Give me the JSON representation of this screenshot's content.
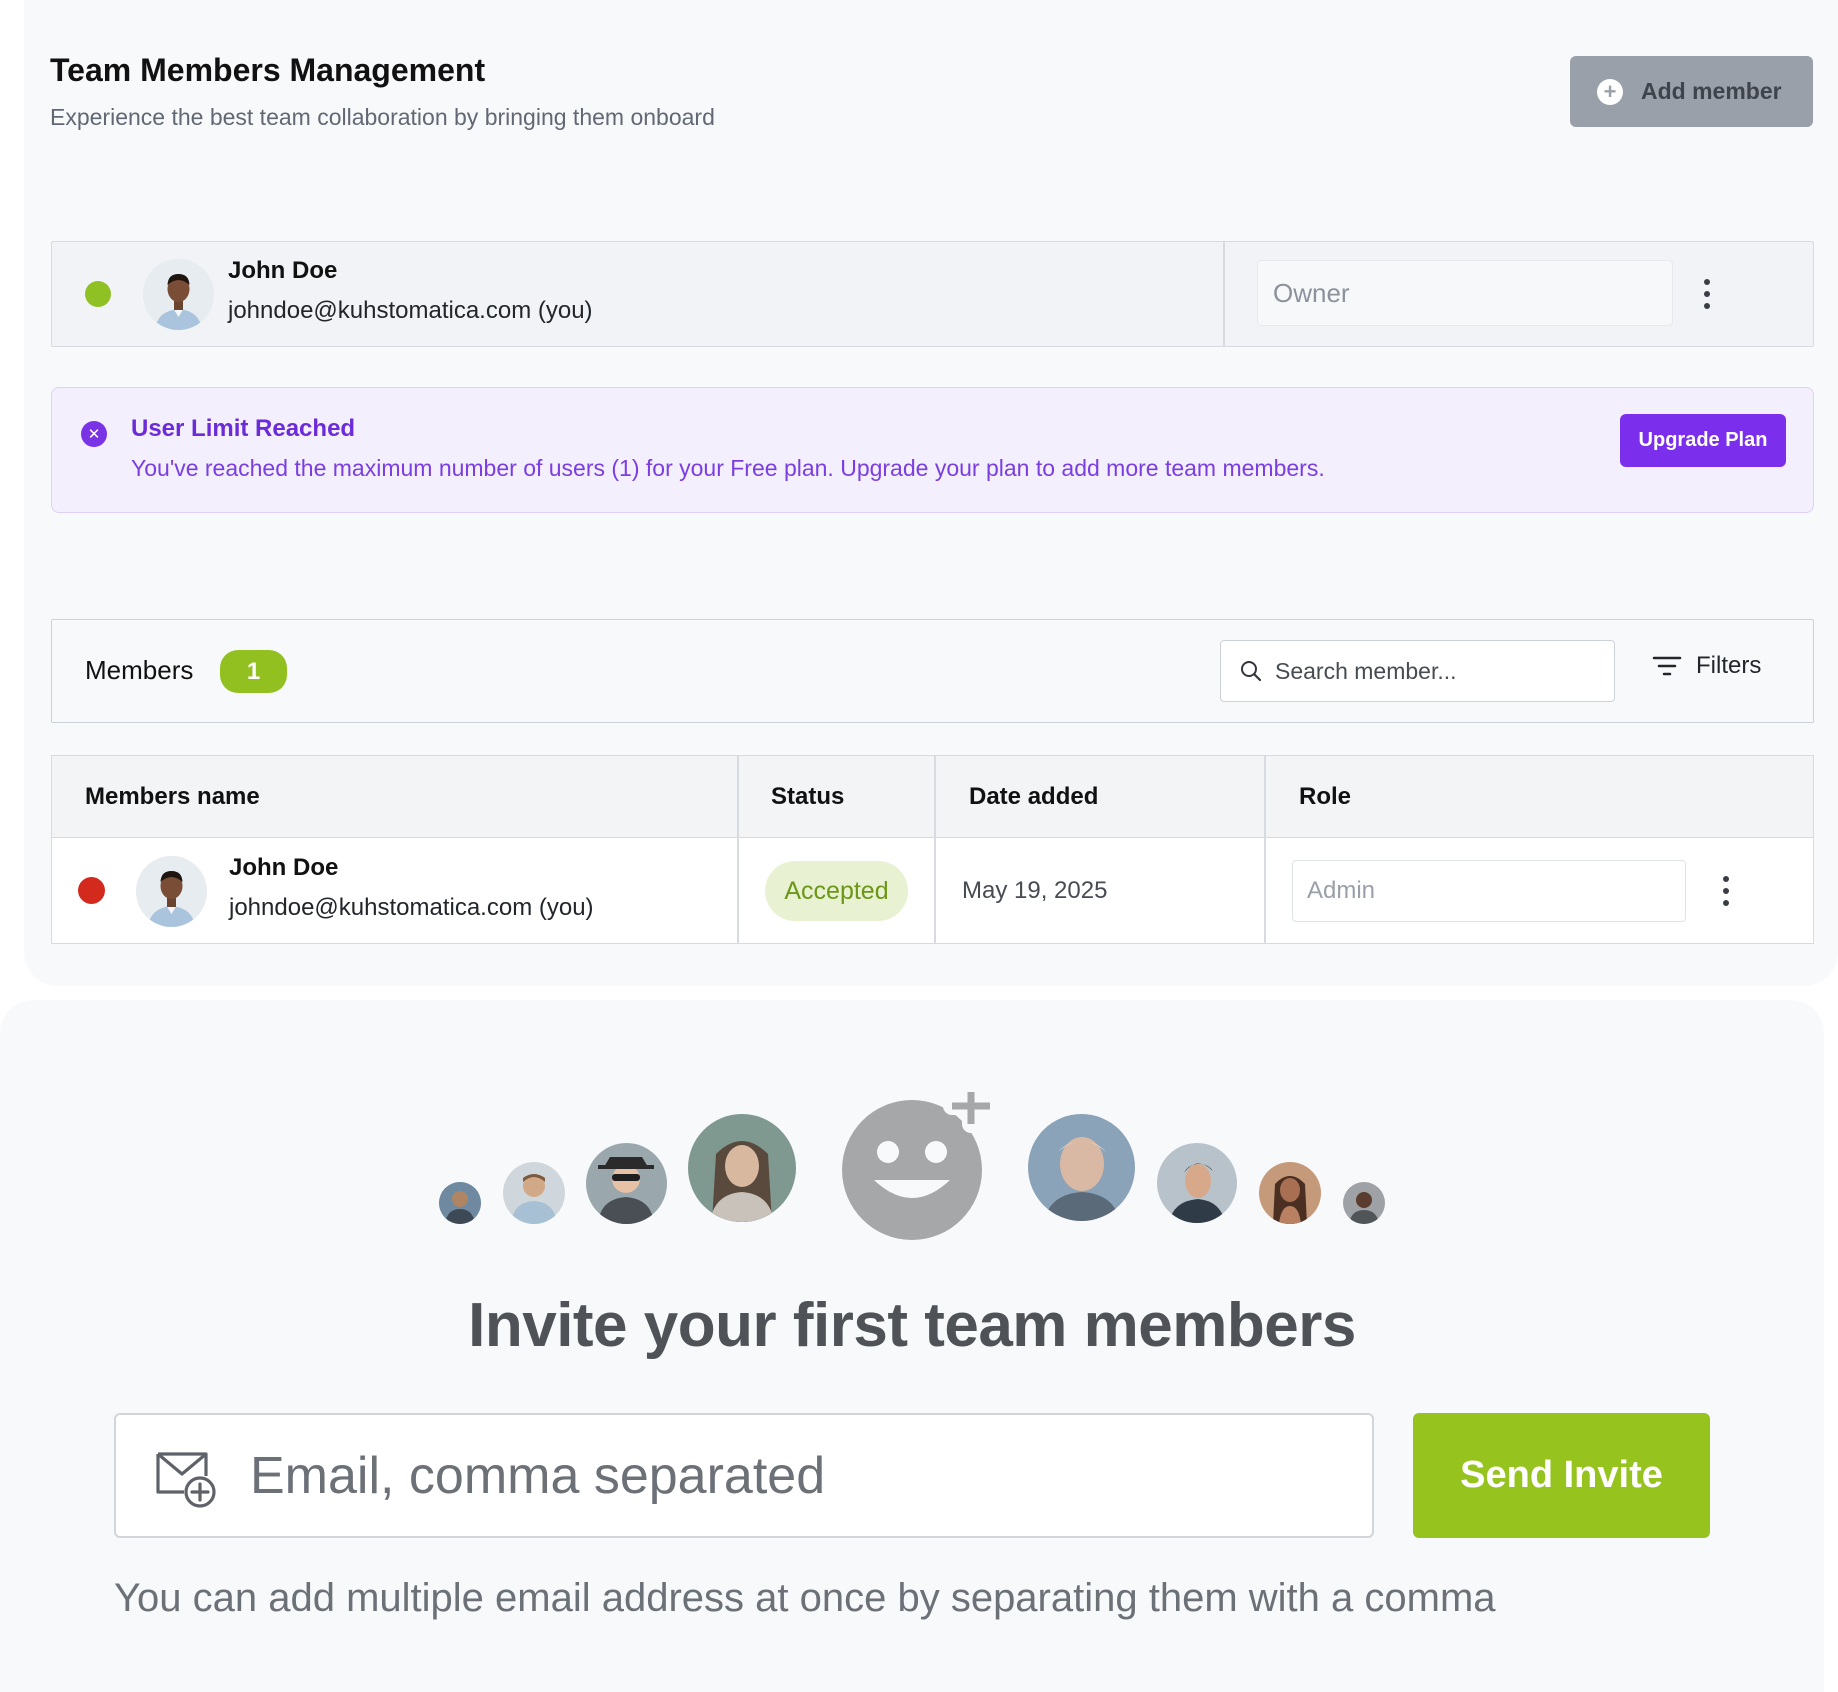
{
  "header": {
    "title": "Team Members Management",
    "subtitle": "Experience the best team collaboration by bringing them onboard",
    "add_member_label": "Add member"
  },
  "owner_card": {
    "name": "John Doe",
    "email": "johndoe@kuhstomatica.com (you)",
    "role_placeholder": "Owner",
    "status_color": "#8fc024"
  },
  "alert": {
    "title": "User Limit Reached",
    "message": "You've reached the maximum number of users (1) for your Free plan. Upgrade your plan to add more team members.",
    "action_label": "Upgrade Plan"
  },
  "members_bar": {
    "label": "Members",
    "count": "1",
    "search_placeholder": "Search member...",
    "filters_label": "Filters"
  },
  "table": {
    "columns": [
      "Members name",
      "Status",
      "Date added",
      "Role"
    ],
    "rows": [
      {
        "name": "John Doe",
        "email": "johndoe@kuhstomatica.com (you)",
        "status": "Accepted",
        "date_added": "May 19, 2025",
        "role_placeholder": "Admin",
        "status_color": "#d42a1e"
      }
    ]
  },
  "invite": {
    "title": "Invite your first team members",
    "email_placeholder": "Email, comma separated",
    "send_label": "Send Invite",
    "hint": "You can add multiple email address at once by separating them with a comma"
  },
  "colors": {
    "accent_green": "#97c31f",
    "accent_purple": "#7b2fed",
    "online_dot": "#8fc024",
    "offline_dot": "#d42a1e"
  }
}
